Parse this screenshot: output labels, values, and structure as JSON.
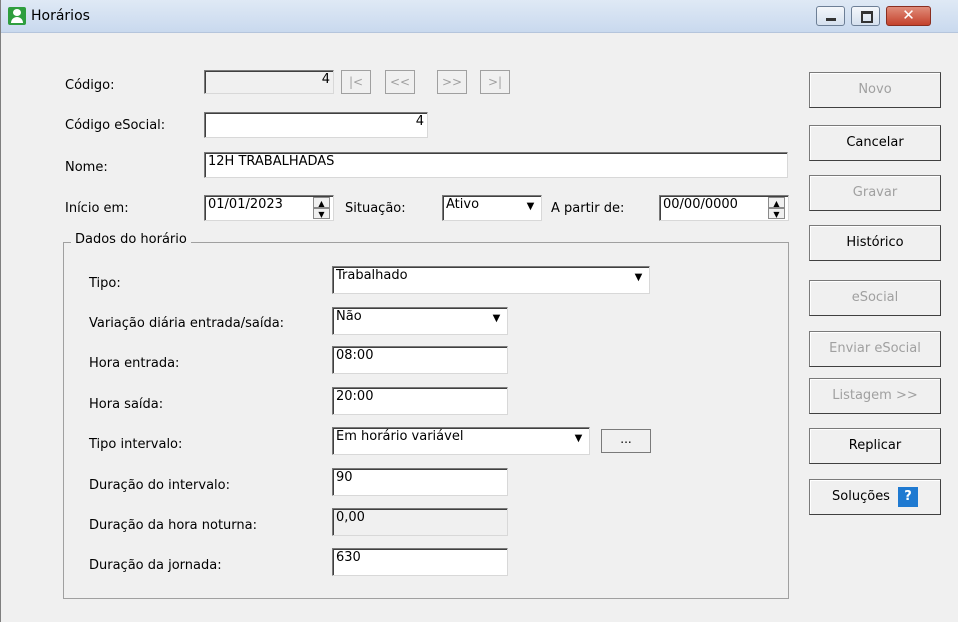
{
  "window": {
    "title": "Horários"
  },
  "form": {
    "codigo": {
      "label": "Código:",
      "value": "4"
    },
    "nav": [
      "|<",
      "<<",
      ">>",
      ">|"
    ],
    "codigo_esocial": {
      "label": "Código eSocial:",
      "value": "4"
    },
    "nome": {
      "label": "Nome:",
      "value": "12H TRABALHADAS"
    },
    "inicio": {
      "label": "Início em:",
      "value": "01/01/2023"
    },
    "situacao": {
      "label": "Situação:",
      "value": "Ativo"
    },
    "a_partir": {
      "label": "A partir de:",
      "value": "00/00/0000"
    }
  },
  "dados": {
    "title": "Dados do horário",
    "tipo": {
      "label": "Tipo:",
      "value": "Trabalhado"
    },
    "variacao": {
      "label": "Variação diária entrada/saída:",
      "value": "Não"
    },
    "hora_entrada": {
      "label": "Hora entrada:",
      "value": "08:00"
    },
    "hora_saida": {
      "label": "Hora saída:",
      "value": "20:00"
    },
    "tipo_intervalo": {
      "label": "Tipo intervalo:",
      "value": "Em horário variável",
      "button": "..."
    },
    "duracao_intervalo": {
      "label": "Duração do intervalo:",
      "value": "90"
    },
    "duracao_noturna": {
      "label": "Duração da hora noturna:",
      "value": "0,00"
    },
    "duracao_jornada": {
      "label": "Duração da jornada:",
      "value": "630"
    }
  },
  "buttons": {
    "novo": "Novo",
    "cancelar": "Cancelar",
    "gravar": "Gravar",
    "historico": "Histórico",
    "esocial": "eSocial",
    "enviar_esocial": "Enviar eSocial",
    "listagem": "Listagem >>",
    "replicar": "Replicar",
    "solucoes": "Soluções",
    "help_icon_glyph": "?"
  },
  "colors": {
    "help_icon": "#1f7ad1",
    "app_icon": "#2e9e3e",
    "close_button": "#c4422c"
  }
}
